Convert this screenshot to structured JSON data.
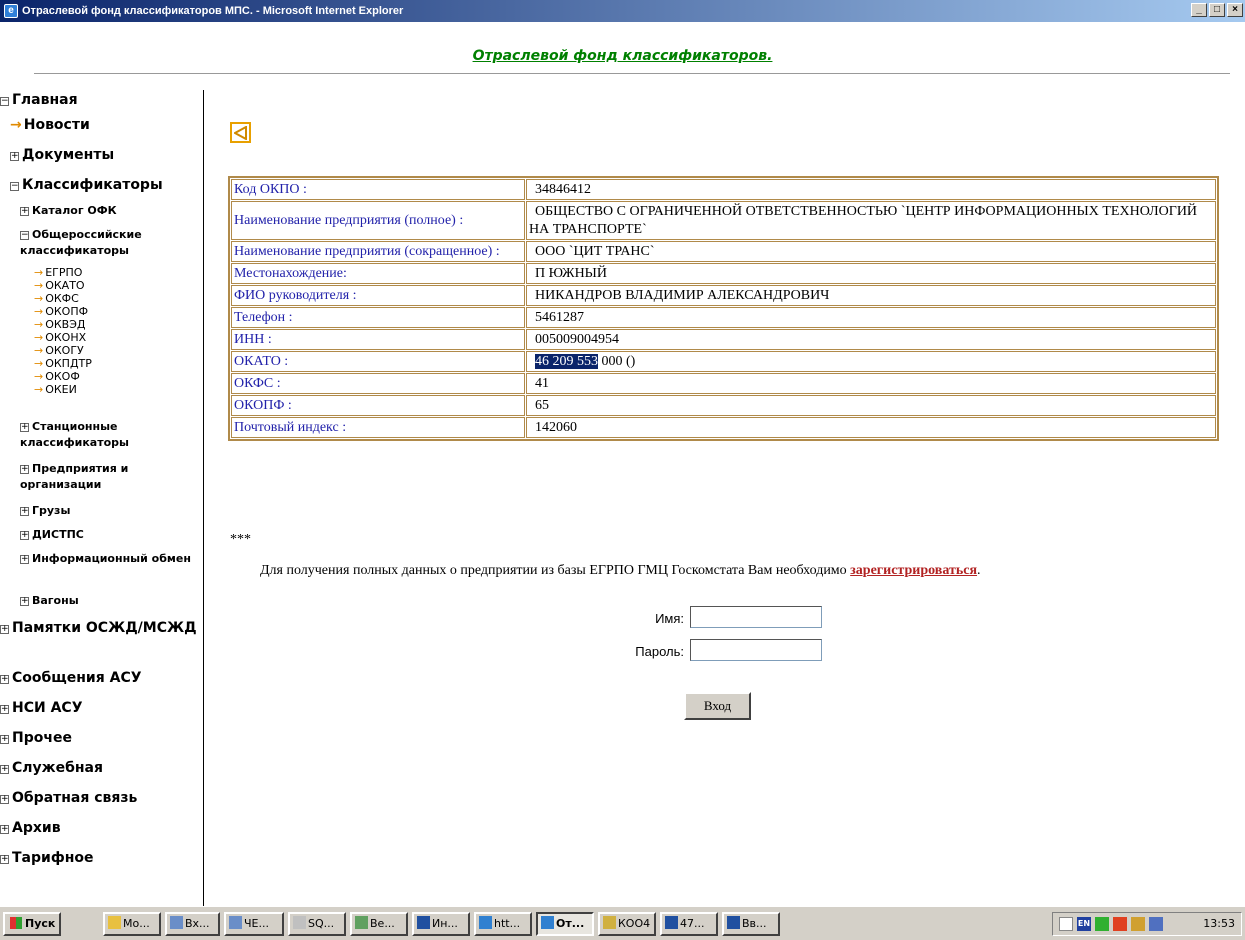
{
  "window": {
    "title": "Отраслевой фонд классификаторов МПС. - Microsoft Internet Explorer",
    "min": "_",
    "max": "□",
    "close": "×"
  },
  "header": {
    "title": "Отраслевой фонд классификаторов."
  },
  "sidebar": {
    "glavnaya": "Главная",
    "novosti": "Новости",
    "dokumenty": "Документы",
    "klassifikatory": "Классификаторы",
    "katalog": "Каталог ОФК",
    "obsherossiyskie": "Общероссийские классификаторы",
    "sub": [
      "ЕГРПО",
      "ОКАТО",
      "ОКФС",
      "ОКОПФ",
      "ОКВЭД",
      "ОКОНХ",
      "ОКОГУ",
      "ОКПДТР",
      "ОКОФ",
      "ОКЕИ"
    ],
    "stantsionnye": "Станционные классификаторы",
    "predpriyatiya": "Предприятия и организации",
    "gruzy": "Грузы",
    "distps": "ДИСТПС",
    "infobmen": "Информационный обмен",
    "vagony": "Вагоны",
    "pamyatki": "Памятки ОСЖД/МСЖД",
    "soobsheniya": "Сообщения АСУ",
    "nsi": "НСИ АСУ",
    "prochee": "Прочее",
    "sluzhebnaya": "Служебная",
    "obratnaya": "Обратная связь",
    "arhiv": "Архив",
    "tarifnoe": "Тарифное"
  },
  "table": {
    "rows": [
      {
        "label": "Код ОКПО :",
        "value": "34846412"
      },
      {
        "label": "Наименование предприятия (полное) :",
        "value": "ОБЩЕСТВО С ОГРАНИЧЕННОЙ ОТВЕТСТВЕННОСТЬЮ `ЦЕНТР ИНФОРМАЦИОННЫХ ТЕХНОЛОГИЙ НА ТРАНСПОРТЕ`"
      },
      {
        "label": "Наименование предприятия (сокращенное) :",
        "value": "ООО `ЦИТ ТРАНС`"
      },
      {
        "label": "Местонахождение:",
        "value": "П ЮЖНЫЙ"
      },
      {
        "label": "ФИО руководителя :",
        "value": "НИКАНДРОВ ВЛАДИМИР АЛЕКСАНДРОВИЧ"
      },
      {
        "label": "Телефон :",
        "value": "5461287"
      },
      {
        "label": "ИНН :",
        "value": "005009004954"
      },
      {
        "label": "ОКАТО :",
        "value_highlight": "46 209 553",
        "value_rest": " 000 ()"
      },
      {
        "label": "ОКФС :",
        "value": "41"
      },
      {
        "label": "ОКОПФ :",
        "value": "65"
      },
      {
        "label": "Почтовый индекс :",
        "value": "142060"
      }
    ]
  },
  "notice": {
    "stars": "***",
    "text": "Для получения полных данных о предприятии из базы ЕГРПО ГМЦ Госкомстата Вам необходимо ",
    "link": "зарегистрироваться",
    "tail": "."
  },
  "login": {
    "name_label": "Имя:",
    "password_label": "Пароль:",
    "button": "Вход"
  },
  "taskbar": {
    "start": "Пуск",
    "tasks": [
      "Мо...",
      "Вх...",
      "ЧЕ...",
      "SQ...",
      "Ве...",
      "Ин...",
      "htt...",
      "От...",
      "КОО4",
      "47...",
      "Вв..."
    ],
    "lang": "EN",
    "clock": "13:53"
  },
  "colors": {
    "header_link": "#008000",
    "label_text": "#2222aa",
    "table_border": "#b08a4a",
    "register_link": "#b22222",
    "bullet_arrow": "#e08a00"
  }
}
